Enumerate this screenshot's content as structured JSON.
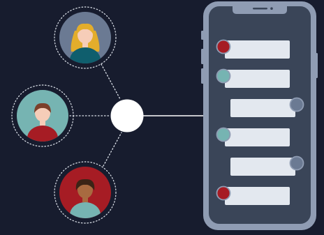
{
  "colors": {
    "background": "#171c2e",
    "phone_frame": "#8f9cb3",
    "phone_screen": "#3a4558",
    "message_bubble": "#e3e8ef",
    "connector": "#dfe4ec",
    "hub": "#ffffff"
  },
  "users": [
    {
      "name": "user-top-avatar",
      "bg": "#6b7a93",
      "hair": "#e3ad2b",
      "skin": "#f6cdb8",
      "shirt": "#0f5e6d"
    },
    {
      "name": "user-middle-avatar",
      "bg": "#76b4b2",
      "hair": "#7c3f2a",
      "skin": "#f6cdb8",
      "shirt": "#a61c24"
    },
    {
      "name": "user-bottom-avatar",
      "bg": "#a61c24",
      "hair": "#3b2416",
      "skin": "#a86a40",
      "shirt": "#76b4b2"
    }
  ],
  "messages": [
    {
      "side": "left",
      "dot": "#a61c24"
    },
    {
      "side": "left",
      "dot": "#76b4b2"
    },
    {
      "side": "right",
      "dot": "#6b7a93"
    },
    {
      "side": "left",
      "dot": "#76b4b2"
    },
    {
      "side": "right",
      "dot": "#6b7a93"
    },
    {
      "side": "left",
      "dot": "#a61c24"
    }
  ]
}
